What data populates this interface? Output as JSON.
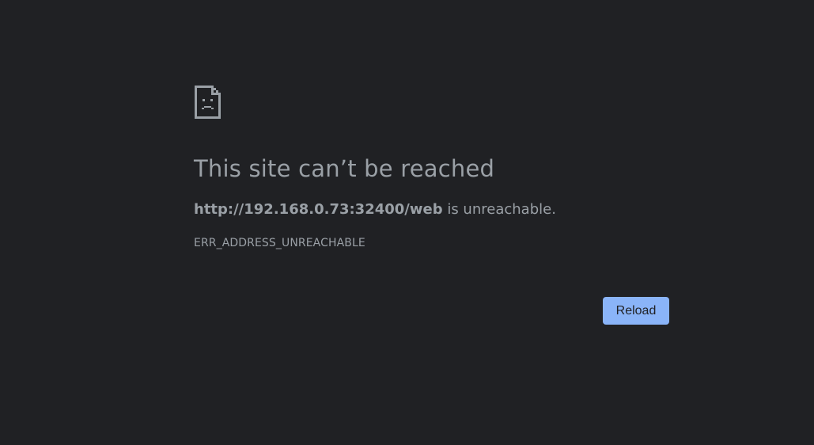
{
  "error": {
    "icon": "sad-document-icon",
    "heading": "This site can’t be reached",
    "url": "http://192.168.0.73:32400/web",
    "summary_suffix": " is unreachable.",
    "code": "ERR_ADDRESS_UNREACHABLE"
  },
  "actions": {
    "reload_label": "Reload"
  },
  "colors": {
    "background": "#202124",
    "text": "#9aa0a6",
    "button": "#8ab4f8",
    "button_text": "#202124"
  }
}
